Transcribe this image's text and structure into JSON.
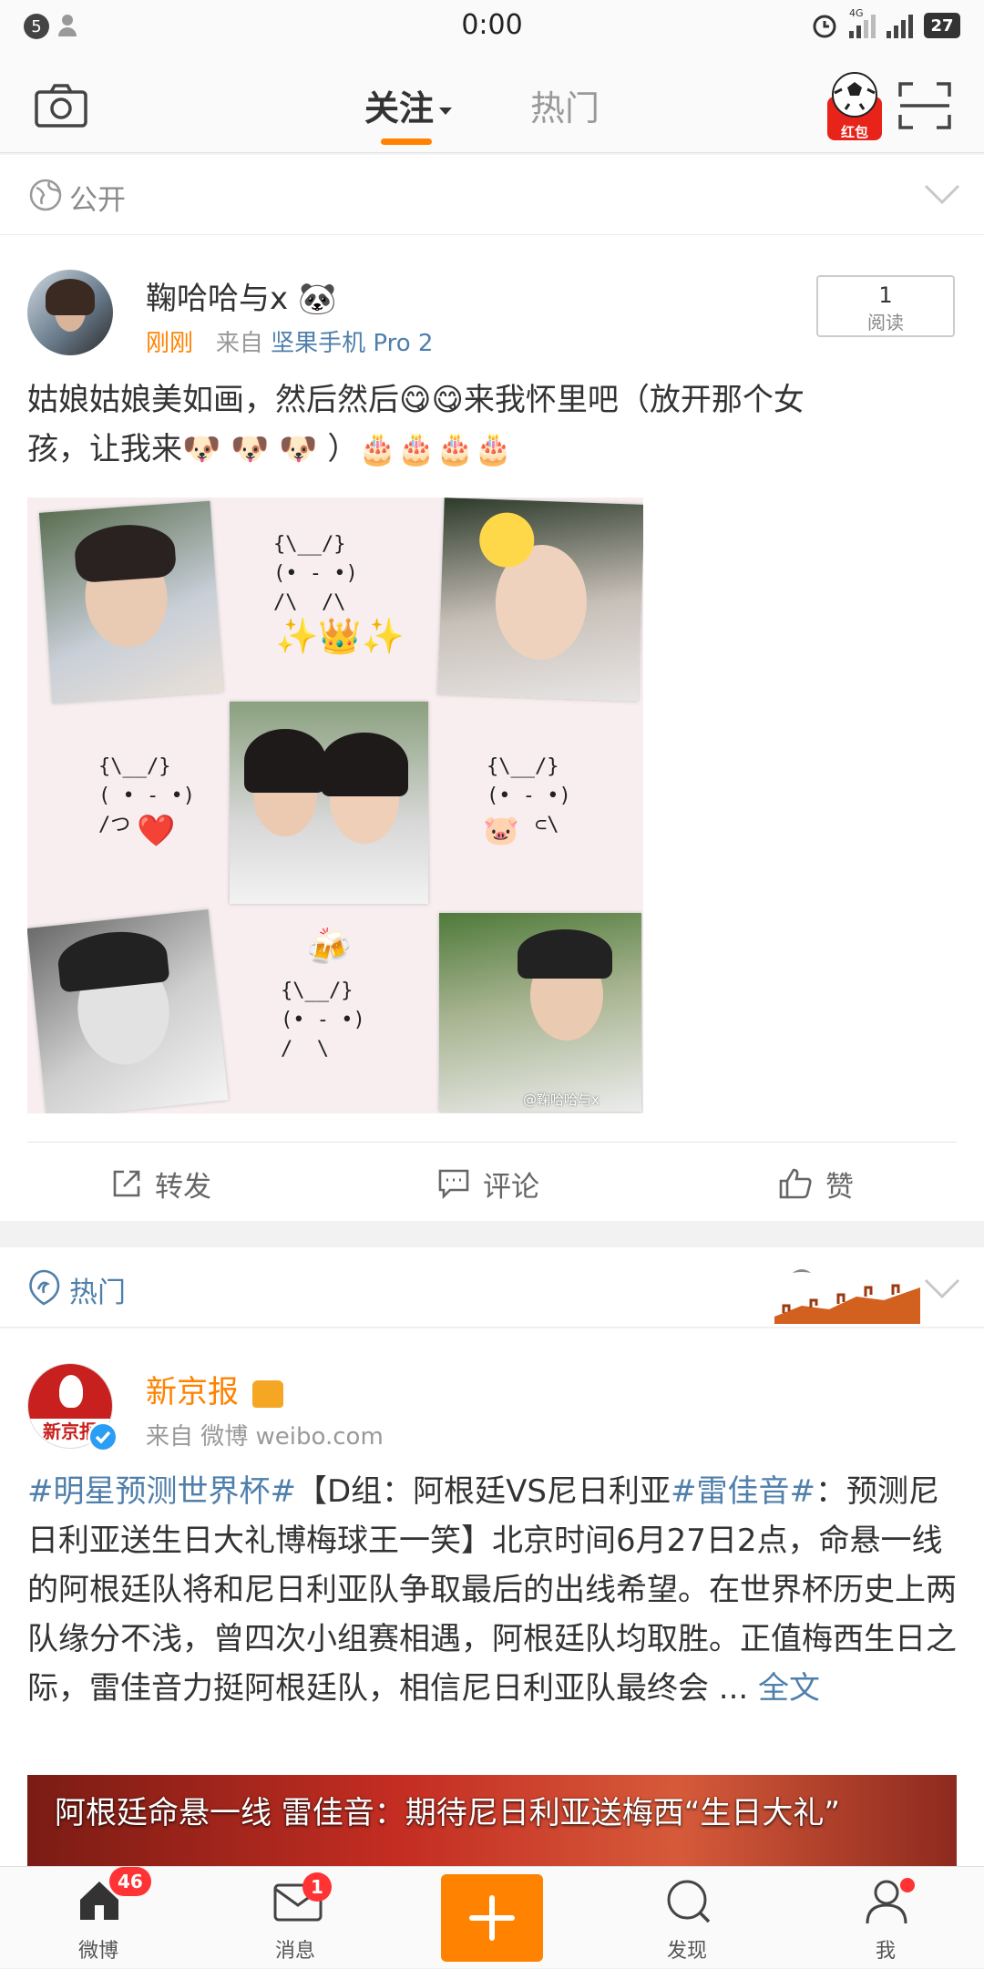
{
  "status": {
    "notif_count": "5",
    "time": "0:00",
    "network": "4G",
    "battery": "27"
  },
  "nav": {
    "tab_follow": "关注",
    "tab_hot": "热门",
    "redpack": "红包"
  },
  "visibility": {
    "label": "公开"
  },
  "post1": {
    "username": "鞠哈哈与x",
    "time": "刚刚",
    "source_prefix": "来自",
    "source": "坚果手机 Pro 2",
    "read_count": "1",
    "read_label": "阅读",
    "text_line1": "姑娘姑娘美如画，然后然后😋😋来我怀里吧（放开那个女",
    "text_line2": "孩，让我来🐶 🐶 🐶 ）🎂🎂🎂🎂",
    "collage": {
      "kaomoji_top": "{\\__/}\n(• - •)\n/\\  /\\",
      "kaomoji_left": "{\\__/}\n( • - •)\n/つ",
      "kaomoji_right": "{\\__/}\n(• - •)\n    ⊂\\",
      "kaomoji_bottom": "{\\__/}\n(• - •)\n/  \\",
      "emoji_crown": "✨👑✨",
      "emoji_heart": "❤️",
      "emoji_pig": "🐷",
      "emoji_beer": "🍻",
      "watermark": "@鞠哈哈与x"
    },
    "actions": {
      "repost": "转发",
      "comment": "评论",
      "like": "赞"
    }
  },
  "hot_section": {
    "label": "热门"
  },
  "post2": {
    "username": "新京报",
    "avatar_text": "新京报",
    "source_prefix": "来自",
    "source": "微博 weibo.com",
    "tag1": "#明星预测世界杯#",
    "seg1": "【D组：阿根廷VS尼日利亚",
    "tag2": "#雷佳音#",
    "seg2": "：预测尼日利亚送生日大礼博梅球王一笑】北京时间6月27日2点，命悬一线的阿根廷队将和尼日利亚队争取最后的出线希望。在世界杯历史上两队缘分不浅，曾四次小组赛相遇，阿根廷队均取胜。正值梅西生日之际，雷佳音力挺阿根廷队，相信尼日利亚队最终会 ... ",
    "full_text": "全文",
    "video_title": "阿根廷命悬一线 雷佳音：期待尼日利亚送梅西“生日大礼”"
  },
  "tabbar": {
    "home": "微博",
    "home_badge": "46",
    "messages": "消息",
    "messages_badge": "1",
    "discover": "发现",
    "me": "我"
  },
  "colors": {
    "accent": "#ff8200",
    "link": "#4f7fab",
    "badge": "#ff3333"
  }
}
